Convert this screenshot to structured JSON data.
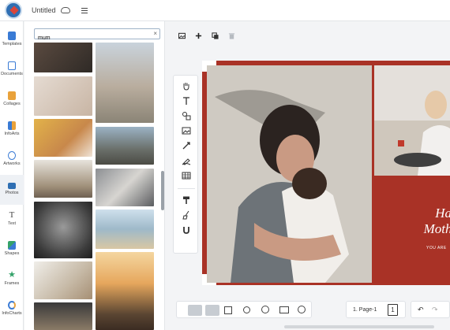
{
  "header": {
    "title": "Untitled",
    "icons": [
      "app-logo",
      "cloud-icon",
      "hamburger-menu-icon"
    ]
  },
  "nav": {
    "items": [
      {
        "label": "Templates",
        "icon": "templates-icon",
        "color": "#3a7bd5"
      },
      {
        "label": "Documents",
        "icon": "document-icon",
        "color": "#3a7bd5"
      },
      {
        "label": "Collages",
        "icon": "collage-icon",
        "color": "#e9a23b"
      },
      {
        "label": "InfoArts",
        "icon": "infoart-icon",
        "color": "#3a7bd5"
      },
      {
        "label": "Artworks",
        "icon": "artwork-icon",
        "color": "#3a7bd5"
      },
      {
        "label": "Photos",
        "icon": "camera-icon",
        "color": "#2f6fb3"
      },
      {
        "label": "Text",
        "icon": "text-icon",
        "color": "#444444"
      },
      {
        "label": "Shapes",
        "icon": "shapes-icon",
        "color": "#35a26a"
      },
      {
        "label": "Frames",
        "icon": "star-icon",
        "color": "#35a26a"
      },
      {
        "label": "InfoCharts",
        "icon": "chart-icon",
        "color": "#3a7bd5"
      }
    ],
    "active": "Photos"
  },
  "search": {
    "value": "mum",
    "clear_label": "×"
  },
  "canvas": {
    "toolbar": [
      "image-icon",
      "plus-icon",
      "duplicate-icon",
      "trash-icon"
    ],
    "tools": [
      "hand-icon",
      "text-tool-icon",
      "shapes-tool-icon",
      "image-tool-icon",
      "line-tool-icon",
      "pen-tool-icon",
      "table-icon",
      "paint-roller-icon",
      "broom-icon",
      "magnet-icon"
    ],
    "card": {
      "title_line1": "Ha",
      "title_line2": "Mothe",
      "subtitle": "YOU ARE"
    },
    "page_label": "1. Page-1",
    "page_count": "1"
  },
  "colors": {
    "accent": "#a93226",
    "nav_active": "#2f6fb3"
  }
}
